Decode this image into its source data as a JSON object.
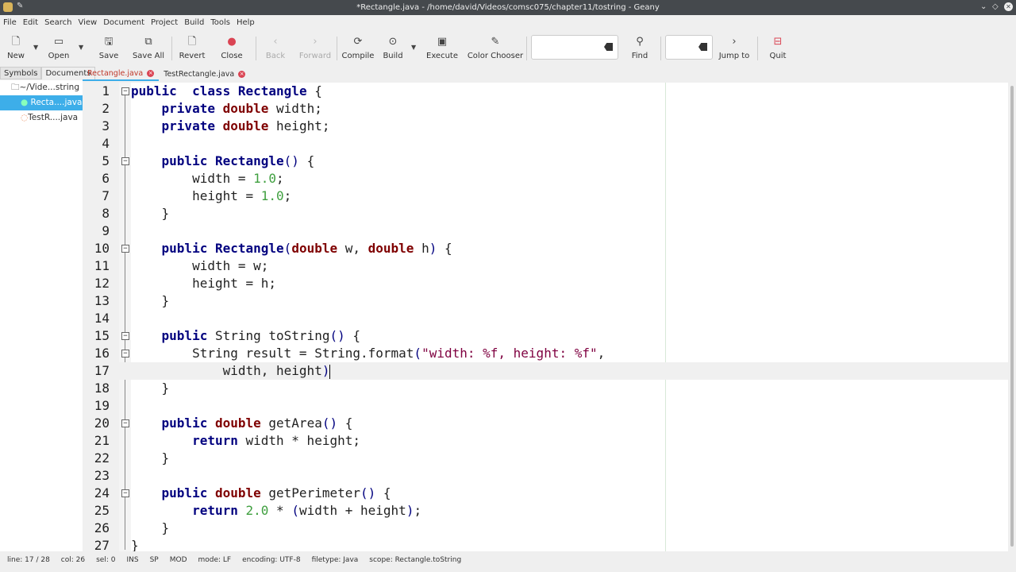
{
  "window": {
    "title": "*Rectangle.java - /home/david/Videos/comsc075/chapter11/tostring - Geany",
    "icon": "geany-icon"
  },
  "menu": [
    "File",
    "Edit",
    "Search",
    "View",
    "Document",
    "Project",
    "Build",
    "Tools",
    "Help"
  ],
  "toolbar": {
    "new": "New",
    "open": "Open",
    "save": "Save",
    "save_all": "Save All",
    "revert": "Revert",
    "close": "Close",
    "back": "Back",
    "forward": "Forward",
    "compile": "Compile",
    "build": "Build",
    "execute": "Execute",
    "color_chooser": "Color Chooser",
    "search_value": "",
    "find": "Find",
    "jump_value": "",
    "jump_to": "Jump to",
    "quit": "Quit"
  },
  "sidebar": {
    "tabs": [
      "Symbols",
      "Documents"
    ],
    "active_tab": "Documents",
    "items": [
      {
        "label": "~/Vide...string",
        "icon": "folder-icon"
      },
      {
        "label": "Recta....java",
        "icon": "file-icon",
        "selected": true
      },
      {
        "label": "TestR....java",
        "icon": "file-icon"
      }
    ]
  },
  "tabs": [
    {
      "label": "Rectangle.java",
      "active": true
    },
    {
      "label": "TestRectangle.java"
    }
  ],
  "editor": {
    "current_line": 17,
    "lines": [
      [
        [
          "kw",
          "public"
        ],
        [
          "",
          "  "
        ],
        [
          "kw",
          "class"
        ],
        [
          "",
          " "
        ],
        [
          "cl",
          "Rectangle"
        ],
        [
          "",
          " {"
        ]
      ],
      [
        [
          "",
          "    "
        ],
        [
          "kw",
          "private"
        ],
        [
          "",
          " "
        ],
        [
          "ty",
          "double"
        ],
        [
          "",
          " width;"
        ]
      ],
      [
        [
          "",
          "    "
        ],
        [
          "kw",
          "private"
        ],
        [
          "",
          " "
        ],
        [
          "ty",
          "double"
        ],
        [
          "",
          " height;"
        ]
      ],
      [],
      [
        [
          "",
          "    "
        ],
        [
          "kw",
          "public"
        ],
        [
          "",
          " "
        ],
        [
          "cl",
          "Rectangle"
        ],
        [
          "op",
          "()"
        ],
        [
          "",
          " {"
        ]
      ],
      [
        [
          "",
          "        width = "
        ],
        [
          "nu",
          "1.0"
        ],
        [
          "",
          ";"
        ]
      ],
      [
        [
          "",
          "        height = "
        ],
        [
          "nu",
          "1.0"
        ],
        [
          "",
          ";"
        ]
      ],
      [
        [
          "",
          "    }"
        ]
      ],
      [],
      [
        [
          "",
          "    "
        ],
        [
          "kw",
          "public"
        ],
        [
          "",
          " "
        ],
        [
          "cl",
          "Rectangle"
        ],
        [
          "op",
          "("
        ],
        [
          "ty",
          "double"
        ],
        [
          "",
          " w, "
        ],
        [
          "ty",
          "double"
        ],
        [
          "",
          " h"
        ],
        [
          "op",
          ")"
        ],
        [
          "",
          " {"
        ]
      ],
      [
        [
          "",
          "        width = w;"
        ]
      ],
      [
        [
          "",
          "        height = h;"
        ]
      ],
      [
        [
          "",
          "    }"
        ]
      ],
      [],
      [
        [
          "",
          "    "
        ],
        [
          "kw",
          "public"
        ],
        [
          "",
          " String toString"
        ],
        [
          "op",
          "()"
        ],
        [
          "",
          " {"
        ]
      ],
      [
        [
          "",
          "        String result = String.format"
        ],
        [
          "op",
          "("
        ],
        [
          "st",
          "\"width: %f, height: %f\""
        ],
        [
          "",
          ","
        ]
      ],
      [
        [
          "",
          "            width, height"
        ],
        [
          "op",
          ")"
        ]
      ],
      [
        [
          "",
          "    }"
        ]
      ],
      [],
      [
        [
          "",
          "    "
        ],
        [
          "kw",
          "public"
        ],
        [
          "",
          " "
        ],
        [
          "ty",
          "double"
        ],
        [
          "",
          " getArea"
        ],
        [
          "op",
          "()"
        ],
        [
          "",
          " {"
        ]
      ],
      [
        [
          "",
          "        "
        ],
        [
          "kw",
          "return"
        ],
        [
          "",
          " width * height;"
        ]
      ],
      [
        [
          "",
          "    }"
        ]
      ],
      [],
      [
        [
          "",
          "    "
        ],
        [
          "kw",
          "public"
        ],
        [
          "",
          " "
        ],
        [
          "ty",
          "double"
        ],
        [
          "",
          " getPerimeter"
        ],
        [
          "op",
          "()"
        ],
        [
          "",
          " {"
        ]
      ],
      [
        [
          "",
          "        "
        ],
        [
          "kw",
          "return"
        ],
        [
          "",
          " "
        ],
        [
          "nu",
          "2.0"
        ],
        [
          "",
          " * "
        ],
        [
          "op",
          "("
        ],
        [
          "",
          "width + height"
        ],
        [
          "op",
          ")"
        ],
        [
          "",
          ";"
        ]
      ],
      [
        [
          "",
          "    }"
        ]
      ],
      [
        [
          "",
          "}"
        ]
      ]
    ],
    "fold_lines": [
      1,
      5,
      10,
      15,
      16,
      20,
      24
    ]
  },
  "status": {
    "line": "line: 17 / 28",
    "col": "col: 26",
    "sel": "sel: 0",
    "ins": "INS",
    "sp": "SP",
    "mod": "MOD",
    "mode": "mode: LF",
    "encoding": "encoding: UTF-8",
    "filetype": "filetype: Java",
    "scope": "scope: Rectangle.toString"
  }
}
